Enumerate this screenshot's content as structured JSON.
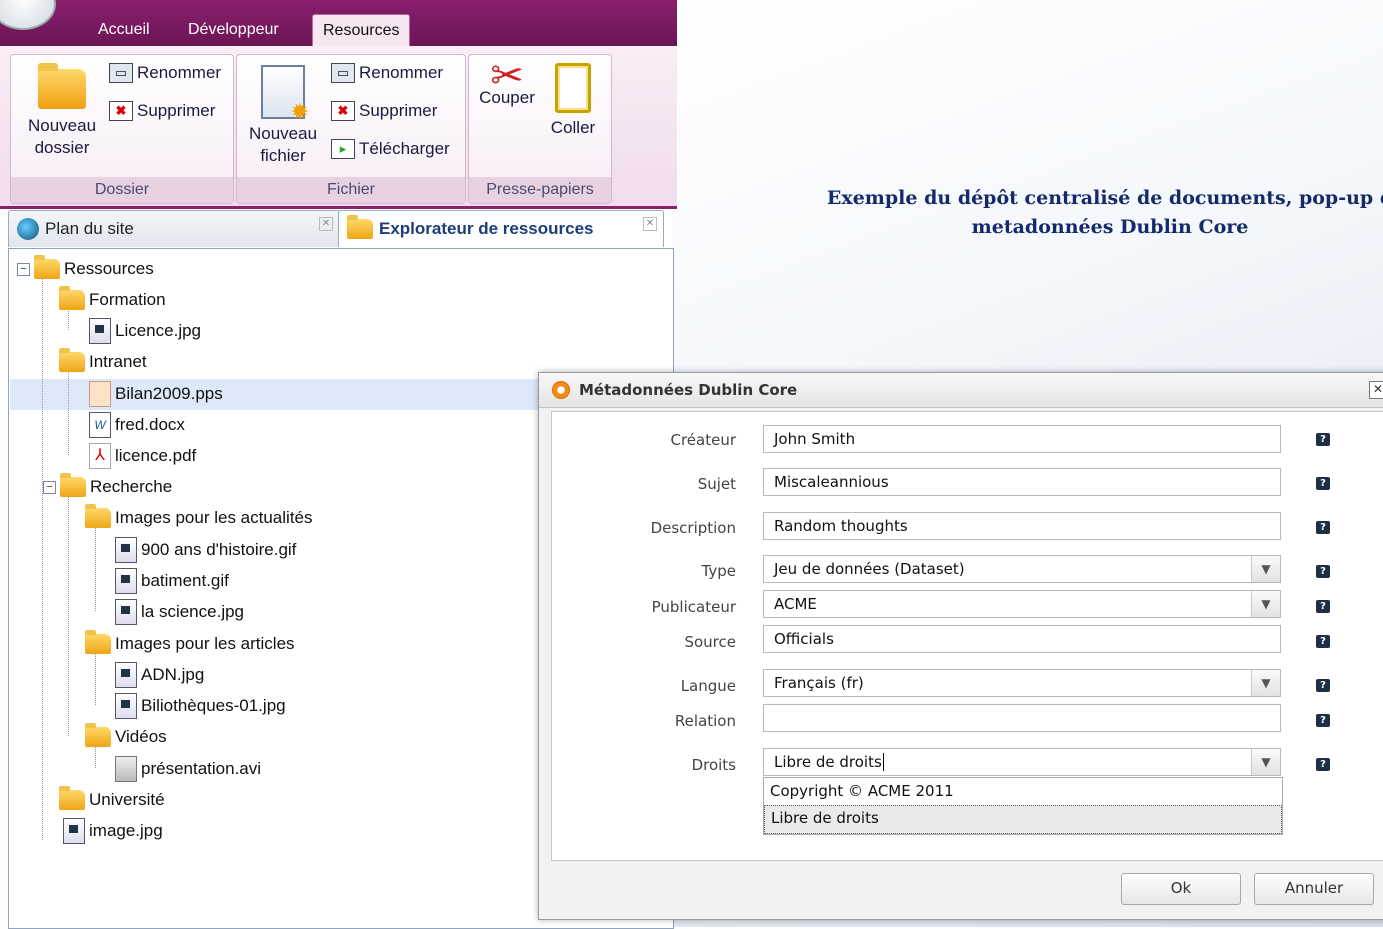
{
  "ribbon": {
    "tabs": [
      {
        "label": "Accueil"
      },
      {
        "label": "Développeur"
      },
      {
        "label": "Resources"
      }
    ],
    "groups": {
      "dossier": {
        "label": "Dossier",
        "new_folder": "Nouveau\ndossier",
        "rename": "Renommer",
        "delete": "Supprimer"
      },
      "fichier": {
        "label": "Fichier",
        "new_file": "Nouveau\nfichier",
        "rename": "Renommer",
        "delete": "Supprimer",
        "download": "Télécharger"
      },
      "clipboard": {
        "label": "Presse-papiers",
        "cut": "Couper",
        "paste": "Coller"
      }
    }
  },
  "caption": {
    "line1": "Exemple du dépôt centralisé de documents, pop-up d",
    "line2": "metadonnées Dublin Core"
  },
  "panel_tabs": {
    "sitemap": "Plan du site",
    "explorer": "Explorateur de ressources"
  },
  "tree": {
    "root": "Ressources",
    "formation": "Formation",
    "licence_jpg": "Licence.jpg",
    "intranet": "Intranet",
    "bilan": "Bilan2009.pps",
    "fred": "fred.docx",
    "licence_pdf": "licence.pdf",
    "recherche": "Recherche",
    "img_actu": "Images pour les actualités",
    "histoire": "900 ans d'histoire.gif",
    "batiment": "batiment.gif",
    "science": "la science.jpg",
    "img_articles": "Images pour les articles",
    "adn": "ADN.jpg",
    "bibli": "Biliothèques-01.jpg",
    "videos": "Vidéos",
    "presentation": "présentation.avi",
    "universite": "Université",
    "image": "image.jpg"
  },
  "dialog": {
    "title": "Métadonnées Dublin Core",
    "fields": {
      "createur": {
        "label": "Créateur",
        "value": "John Smith"
      },
      "sujet": {
        "label": "Sujet",
        "value": "Miscaleannious"
      },
      "description": {
        "label": "Description",
        "value": "Random thoughts"
      },
      "type": {
        "label": "Type",
        "value": "Jeu de données (Dataset)"
      },
      "publicateur": {
        "label": "Publicateur",
        "value": "ACME"
      },
      "source": {
        "label": "Source",
        "value": "Officials"
      },
      "langue": {
        "label": "Langue",
        "value": "Français (fr)"
      },
      "relation": {
        "label": "Relation",
        "value": ""
      },
      "droits": {
        "label": "Droits",
        "value": "Libre de droits"
      }
    },
    "droits_options": [
      "Copyright © ACME 2011",
      "Libre de droits"
    ],
    "help": "?",
    "ok": "Ok",
    "cancel": "Annuler"
  }
}
